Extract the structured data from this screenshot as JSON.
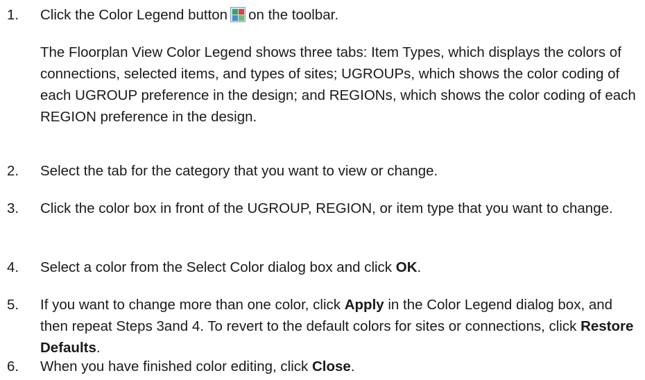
{
  "steps": [
    {
      "num": "1.",
      "text_before": "Click the Color Legend button",
      "icon": "color-legend-icon",
      "text_after": "on the toolbar.",
      "note": "The Floorplan View Color Legend shows three tabs: Item Types, which displays the colors of connections, selected items, and types of sites; UGROUPs, which shows the color coding of each UGROUP preference in the design; and REGIONs, which shows the color coding of each REGION preference in the design."
    },
    {
      "num": "2.",
      "text": "Select the tab for the category that you want to view or change."
    },
    {
      "num": "3.",
      "text": "Click the color box in front of the UGROUP, REGION, or item type that you want to change."
    },
    {
      "num": "4.",
      "text_before": "Select a color from the Select Color dialog box and click ",
      "bold": "OK",
      "text_after": "."
    },
    {
      "num": "5.",
      "text_a": "If you want to change more than one color, click ",
      "bold_a": "Apply",
      "text_b": " in the Color Legend dialog box, and then repeat Steps 3and 4. To revert to the default colors for sites or connections, click ",
      "bold_b": "Restore Defaults",
      "text_c": "."
    },
    {
      "num": "6.",
      "text_before": "When you have finished color editing, click ",
      "bold": "Close",
      "text_after": "."
    }
  ],
  "icon_colors": [
    "#3aa655",
    "#e0452f",
    "#4a8fd1",
    "#6cc070"
  ]
}
